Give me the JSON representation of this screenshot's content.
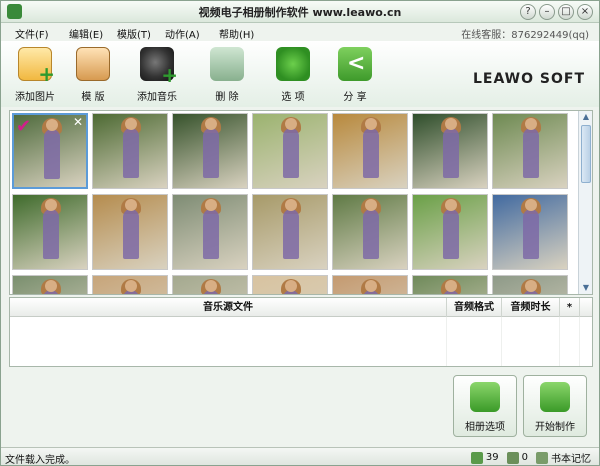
{
  "window": {
    "title": "视频电子相册制作软件 www.leawo.cn",
    "controls": [
      "?",
      "–",
      "□",
      "×"
    ]
  },
  "menu": {
    "items": [
      "文件(F)",
      "编辑(E)",
      "模版(T)",
      "动作(A)",
      "帮助(H)"
    ],
    "service": "在线客服：876292449(qq)"
  },
  "toolbar": {
    "buttons": [
      {
        "label": "添加图片",
        "icon": "add-photo-icon"
      },
      {
        "label": "模 版",
        "icon": "template-icon"
      },
      {
        "label": "添加音乐",
        "icon": "add-music-icon"
      },
      {
        "label": "删 除",
        "icon": "trash-icon"
      },
      {
        "label": "选 项",
        "icon": "gears-icon"
      },
      {
        "label": "分 享",
        "icon": "share-icon"
      }
    ],
    "logo": "LEAWO SOFT"
  },
  "gallery": {
    "rows_visible": 3,
    "thumbs": [
      {
        "bg": "#4f6b3d"
      },
      {
        "bg": "#4d6a33"
      },
      {
        "bg": "#36522b"
      },
      {
        "bg": "#9bb36f"
      },
      {
        "bg": "#b8893d"
      },
      {
        "bg": "#2f4e2b"
      },
      {
        "bg": "#6e8a52"
      },
      {
        "bg": "#3f6b2c"
      },
      {
        "bg": "#b58c4e"
      },
      {
        "bg": "#7e8c74"
      },
      {
        "bg": "#a79a69"
      },
      {
        "bg": "#5f7a45"
      },
      {
        "bg": "#6aa047"
      },
      {
        "bg": "#426aa0"
      },
      {
        "bg": "#7a8f6e"
      },
      {
        "bg": "#c7a57a"
      },
      {
        "bg": "#a4a98f"
      },
      {
        "bg": "#d8c3a0"
      },
      {
        "bg": "#c49a70"
      },
      {
        "bg": "#6f8a5a"
      },
      {
        "bg": "#8e9a88"
      }
    ]
  },
  "music_table": {
    "columns": [
      "音乐源文件",
      "音频格式",
      "音频时长",
      "*"
    ]
  },
  "actions": {
    "album_settings": "相册选项",
    "start": "开始制作"
  },
  "status": {
    "message": "文件载入完成。",
    "photos_count": "39",
    "music_count": "0",
    "notes_label": "书本记忆"
  },
  "colors": {
    "selection_border": "#5c9bd8",
    "checkmark": "#d11f8a",
    "accent_green": "#3a9a28"
  }
}
